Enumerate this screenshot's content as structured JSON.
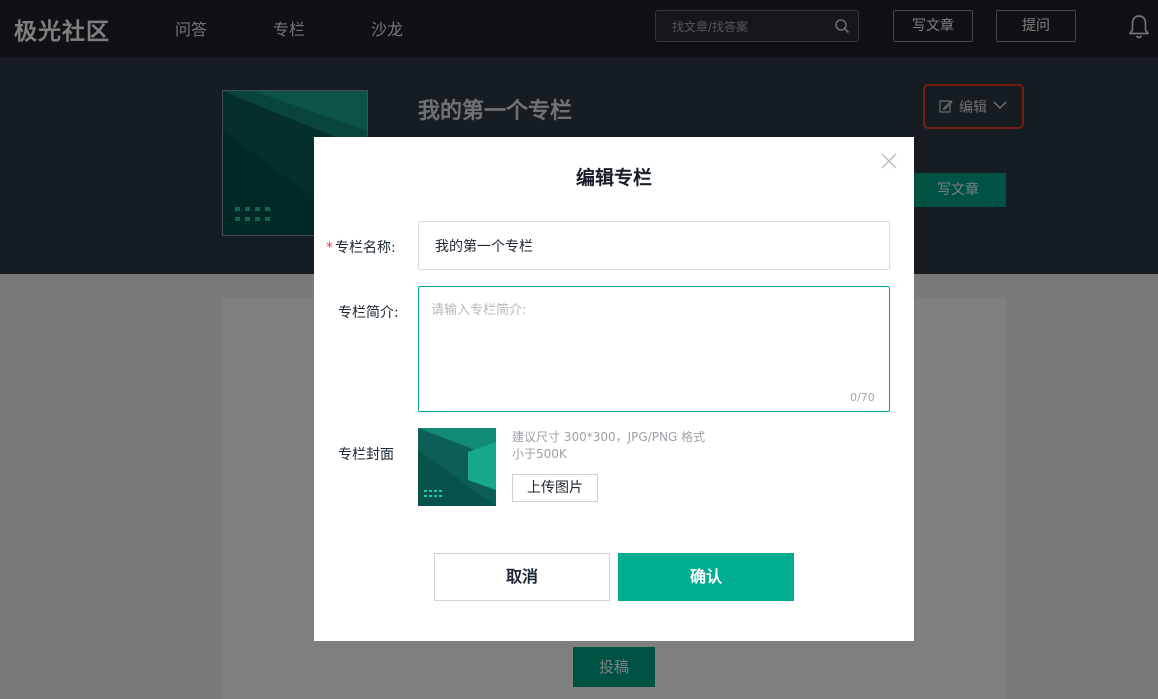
{
  "nav": {
    "logo": "极光社区",
    "items": [
      "问答",
      "专栏",
      "沙龙"
    ],
    "search_placeholder": "找文章/找答案",
    "write_label": "写文章",
    "ask_label": "提问"
  },
  "column": {
    "title": "我的第一个专栏",
    "edit_label": "编辑",
    "write_label": "写文章",
    "submit_label": "投稿"
  },
  "modal": {
    "title": "编辑专栏",
    "name_label": "专栏名称:",
    "required_mark": "*",
    "name_value": "我的第一个专栏",
    "desc_label": "专栏简介:",
    "desc_placeholder": "请输入专栏简介:",
    "desc_counter": "0/70",
    "cover_label": "专栏封面",
    "cover_hint": "建议尺寸 300*300，JPG/PNG 格式 小于500K",
    "upload_label": "上传图片",
    "cancel_label": "取消",
    "confirm_label": "确认"
  },
  "colors": {
    "nav_bg": "#1e2228",
    "header_bg": "#2b3a47",
    "accent": "#00a58b",
    "highlight_border": "#ef3b2c"
  }
}
